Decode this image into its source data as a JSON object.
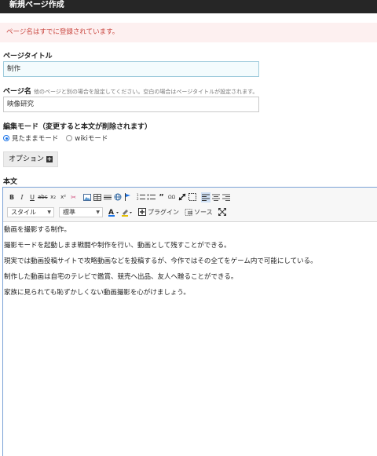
{
  "header": {
    "title": "新規ページ作成"
  },
  "alert": {
    "message": "ページ名はすでに登録されています。"
  },
  "form": {
    "title_label": "ページタイトル",
    "title_value": "制作",
    "name_label": "ページ名",
    "name_hint": "他のページと別の場合を設定してください。空白の場合はページタイトルが設定されます。",
    "name_value": "映像研究",
    "mode_label": "編集モード（変更すると本文が削除されます）",
    "mode_options": [
      "見たままモード",
      "wikiモード"
    ],
    "options_button": "オプション",
    "body_label": "本文"
  },
  "toolbar": {
    "style_select": "スタイル",
    "format_select": "標準",
    "plugin_label": "プラグイン",
    "source_label": "ソース"
  },
  "content": {
    "paragraphs": [
      "動画を撮影する制作。",
      "撮影モードを起動しまま戦闘や制作を行い、動画として残すことができる。",
      "現実では動画投稿サイトで攻略動画などを投稿するが、今作ではその全てをゲーム内で可能にしている。",
      "制作した動画は自宅のテレビで鑑賞、競売へ出品、友人へ贈ることができる。",
      "家族に見られても恥ずかしくない動画撮影を心がけましょう。"
    ]
  },
  "colors": {
    "titlebar": "#262626",
    "alert_bg": "#fdf0f0",
    "alert_text": "#c9453e",
    "editor_border": "#7aa2d6"
  }
}
